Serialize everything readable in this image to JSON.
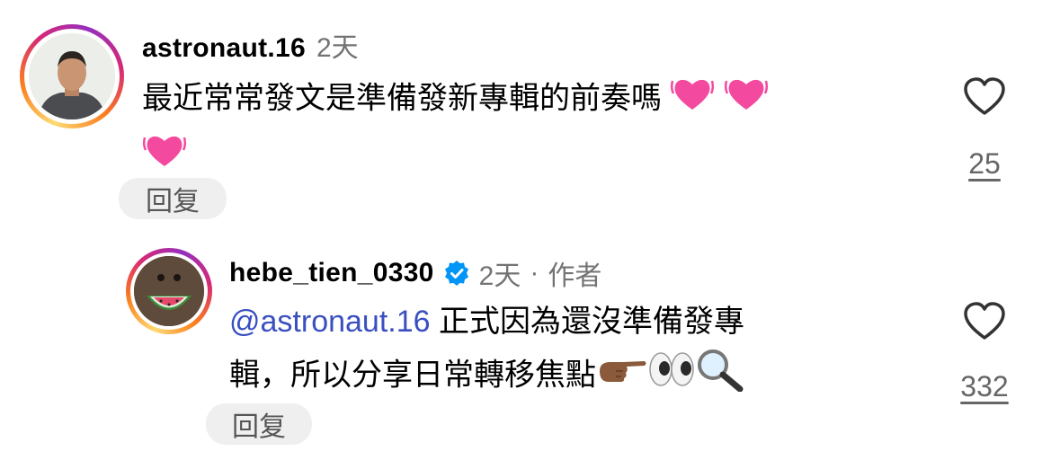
{
  "comment": {
    "username": "astronaut.16",
    "time": "2天",
    "text_line1": "最近常常發文是準備發新專輯的前奏嗎",
    "reply_label": "回复",
    "like_count": "25"
  },
  "reply": {
    "username": "hebe_tien_0330",
    "verified": true,
    "time": "2天",
    "separator": "·",
    "author_label": "作者",
    "mention": "@astronaut.16",
    "text_line1": "正式因為還沒準備發專",
    "text_line2": "輯，所以分享日常轉移焦點",
    "reply_label": "回复",
    "like_count": "332"
  },
  "colors": {
    "mention": "#3a4fc0",
    "verified_badge": "#0095f6",
    "meta_text": "#737373"
  },
  "icons": {
    "heart_emoji": "growing-heart",
    "finger_emoji": "pointing-right-medium-dark-skin",
    "eyes_emoji": "eyes",
    "magnifier_emoji": "magnifying-glass-left"
  }
}
